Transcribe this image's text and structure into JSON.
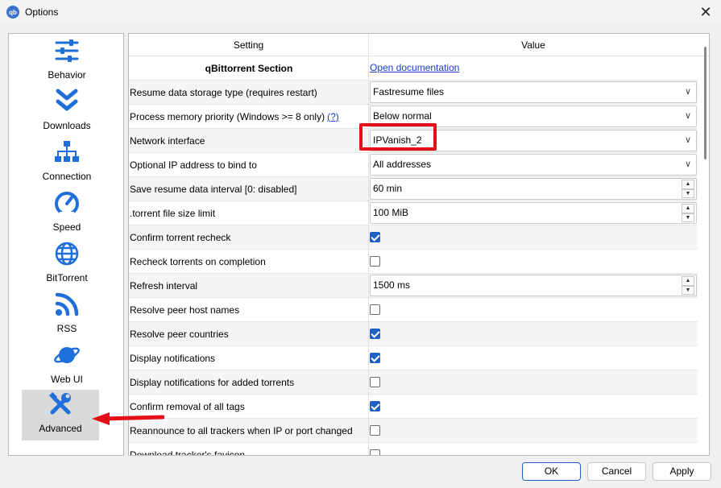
{
  "window": {
    "title": "Options",
    "app_icon": "qb",
    "close": "✕"
  },
  "sidebar": {
    "items": [
      {
        "label": "Behavior",
        "icon": "sliders-icon"
      },
      {
        "label": "Downloads",
        "icon": "double-chevron-down-icon"
      },
      {
        "label": "Connection",
        "icon": "network-tree-icon"
      },
      {
        "label": "Speed",
        "icon": "speedometer-icon"
      },
      {
        "label": "BitTorrent",
        "icon": "globe-icon"
      },
      {
        "label": "RSS",
        "icon": "rss-icon"
      },
      {
        "label": "Web UI",
        "icon": "planet-icon"
      },
      {
        "label": "Advanced",
        "icon": "tools-icon",
        "active": true
      }
    ]
  },
  "table": {
    "headers": {
      "setting": "Setting",
      "value": "Value"
    },
    "section": {
      "label": "qBittorrent Section",
      "link": "Open documentation"
    },
    "rows": [
      {
        "setting": "Resume data storage type (requires restart)",
        "type": "combo",
        "value": "Fastresume files"
      },
      {
        "setting": "Process memory priority (Windows >= 8 only)",
        "help": "(?)",
        "type": "combo",
        "value": "Below normal"
      },
      {
        "setting": "Network interface",
        "type": "combo",
        "value": "IPVanish_2"
      },
      {
        "setting": "Optional IP address to bind to",
        "type": "combo",
        "value": "All addresses"
      },
      {
        "setting": "Save resume data interval [0: disabled]",
        "type": "spin",
        "value": "60 min"
      },
      {
        "setting": ".torrent file size limit",
        "type": "spin",
        "value": "100 MiB"
      },
      {
        "setting": "Confirm torrent recheck",
        "type": "check",
        "checked": true
      },
      {
        "setting": "Recheck torrents on completion",
        "type": "check",
        "checked": false
      },
      {
        "setting": "Refresh interval",
        "type": "spin",
        "value": "1500 ms"
      },
      {
        "setting": "Resolve peer host names",
        "type": "check",
        "checked": false
      },
      {
        "setting": "Resolve peer countries",
        "type": "check",
        "checked": true
      },
      {
        "setting": "Display notifications",
        "type": "check",
        "checked": true
      },
      {
        "setting": "Display notifications for added torrents",
        "type": "check",
        "checked": false
      },
      {
        "setting": "Confirm removal of all tags",
        "type": "check",
        "checked": true
      },
      {
        "setting": "Reannounce to all trackers when IP or port changed",
        "type": "check",
        "checked": false
      },
      {
        "setting": "Download tracker's favicon",
        "type": "check",
        "checked": false
      }
    ]
  },
  "buttons": {
    "ok": "OK",
    "cancel": "Cancel",
    "apply": "Apply"
  },
  "colors": {
    "accent": "#1f5fc7",
    "icon_blue": "#1e6fd9",
    "highlight": "#e3101a",
    "link": "#1a3dc9"
  }
}
